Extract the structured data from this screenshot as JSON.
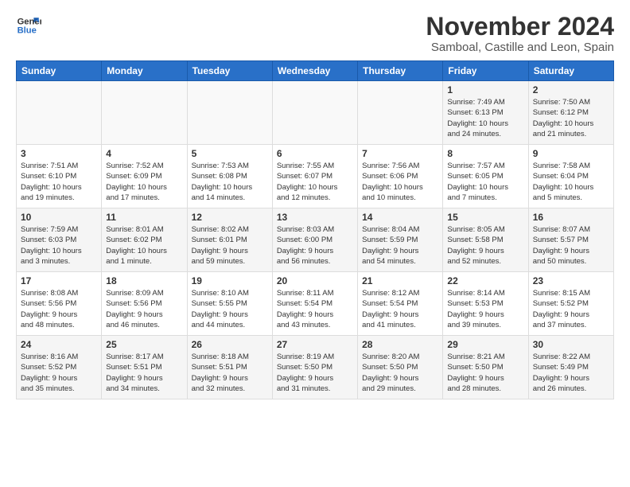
{
  "logo": {
    "line1": "General",
    "line2": "Blue"
  },
  "title": "November 2024",
  "location": "Samboal, Castille and Leon, Spain",
  "weekdays": [
    "Sunday",
    "Monday",
    "Tuesday",
    "Wednesday",
    "Thursday",
    "Friday",
    "Saturday"
  ],
  "weeks": [
    [
      {
        "day": "",
        "info": ""
      },
      {
        "day": "",
        "info": ""
      },
      {
        "day": "",
        "info": ""
      },
      {
        "day": "",
        "info": ""
      },
      {
        "day": "",
        "info": ""
      },
      {
        "day": "1",
        "info": "Sunrise: 7:49 AM\nSunset: 6:13 PM\nDaylight: 10 hours\nand 24 minutes."
      },
      {
        "day": "2",
        "info": "Sunrise: 7:50 AM\nSunset: 6:12 PM\nDaylight: 10 hours\nand 21 minutes."
      }
    ],
    [
      {
        "day": "3",
        "info": "Sunrise: 7:51 AM\nSunset: 6:10 PM\nDaylight: 10 hours\nand 19 minutes."
      },
      {
        "day": "4",
        "info": "Sunrise: 7:52 AM\nSunset: 6:09 PM\nDaylight: 10 hours\nand 17 minutes."
      },
      {
        "day": "5",
        "info": "Sunrise: 7:53 AM\nSunset: 6:08 PM\nDaylight: 10 hours\nand 14 minutes."
      },
      {
        "day": "6",
        "info": "Sunrise: 7:55 AM\nSunset: 6:07 PM\nDaylight: 10 hours\nand 12 minutes."
      },
      {
        "day": "7",
        "info": "Sunrise: 7:56 AM\nSunset: 6:06 PM\nDaylight: 10 hours\nand 10 minutes."
      },
      {
        "day": "8",
        "info": "Sunrise: 7:57 AM\nSunset: 6:05 PM\nDaylight: 10 hours\nand 7 minutes."
      },
      {
        "day": "9",
        "info": "Sunrise: 7:58 AM\nSunset: 6:04 PM\nDaylight: 10 hours\nand 5 minutes."
      }
    ],
    [
      {
        "day": "10",
        "info": "Sunrise: 7:59 AM\nSunset: 6:03 PM\nDaylight: 10 hours\nand 3 minutes."
      },
      {
        "day": "11",
        "info": "Sunrise: 8:01 AM\nSunset: 6:02 PM\nDaylight: 10 hours\nand 1 minute."
      },
      {
        "day": "12",
        "info": "Sunrise: 8:02 AM\nSunset: 6:01 PM\nDaylight: 9 hours\nand 59 minutes."
      },
      {
        "day": "13",
        "info": "Sunrise: 8:03 AM\nSunset: 6:00 PM\nDaylight: 9 hours\nand 56 minutes."
      },
      {
        "day": "14",
        "info": "Sunrise: 8:04 AM\nSunset: 5:59 PM\nDaylight: 9 hours\nand 54 minutes."
      },
      {
        "day": "15",
        "info": "Sunrise: 8:05 AM\nSunset: 5:58 PM\nDaylight: 9 hours\nand 52 minutes."
      },
      {
        "day": "16",
        "info": "Sunrise: 8:07 AM\nSunset: 5:57 PM\nDaylight: 9 hours\nand 50 minutes."
      }
    ],
    [
      {
        "day": "17",
        "info": "Sunrise: 8:08 AM\nSunset: 5:56 PM\nDaylight: 9 hours\nand 48 minutes."
      },
      {
        "day": "18",
        "info": "Sunrise: 8:09 AM\nSunset: 5:56 PM\nDaylight: 9 hours\nand 46 minutes."
      },
      {
        "day": "19",
        "info": "Sunrise: 8:10 AM\nSunset: 5:55 PM\nDaylight: 9 hours\nand 44 minutes."
      },
      {
        "day": "20",
        "info": "Sunrise: 8:11 AM\nSunset: 5:54 PM\nDaylight: 9 hours\nand 43 minutes."
      },
      {
        "day": "21",
        "info": "Sunrise: 8:12 AM\nSunset: 5:54 PM\nDaylight: 9 hours\nand 41 minutes."
      },
      {
        "day": "22",
        "info": "Sunrise: 8:14 AM\nSunset: 5:53 PM\nDaylight: 9 hours\nand 39 minutes."
      },
      {
        "day": "23",
        "info": "Sunrise: 8:15 AM\nSunset: 5:52 PM\nDaylight: 9 hours\nand 37 minutes."
      }
    ],
    [
      {
        "day": "24",
        "info": "Sunrise: 8:16 AM\nSunset: 5:52 PM\nDaylight: 9 hours\nand 35 minutes."
      },
      {
        "day": "25",
        "info": "Sunrise: 8:17 AM\nSunset: 5:51 PM\nDaylight: 9 hours\nand 34 minutes."
      },
      {
        "day": "26",
        "info": "Sunrise: 8:18 AM\nSunset: 5:51 PM\nDaylight: 9 hours\nand 32 minutes."
      },
      {
        "day": "27",
        "info": "Sunrise: 8:19 AM\nSunset: 5:50 PM\nDaylight: 9 hours\nand 31 minutes."
      },
      {
        "day": "28",
        "info": "Sunrise: 8:20 AM\nSunset: 5:50 PM\nDaylight: 9 hours\nand 29 minutes."
      },
      {
        "day": "29",
        "info": "Sunrise: 8:21 AM\nSunset: 5:50 PM\nDaylight: 9 hours\nand 28 minutes."
      },
      {
        "day": "30",
        "info": "Sunrise: 8:22 AM\nSunset: 5:49 PM\nDaylight: 9 hours\nand 26 minutes."
      }
    ]
  ]
}
